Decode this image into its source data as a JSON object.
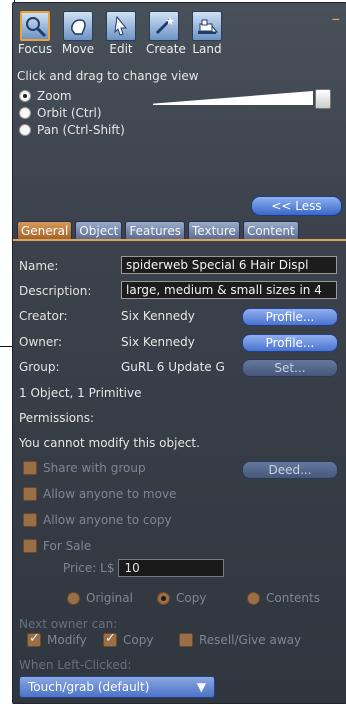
{
  "window": {
    "close_glyph": "–"
  },
  "tools": [
    {
      "label": "Focus",
      "icon": "magnifier-icon"
    },
    {
      "label": "Move",
      "icon": "hand-icon"
    },
    {
      "label": "Edit",
      "icon": "cursor-icon"
    },
    {
      "label": "Create",
      "icon": "wand-icon"
    },
    {
      "label": "Land",
      "icon": "bulldozer-icon"
    }
  ],
  "focus": {
    "hint": "Click and drag to change view",
    "options": [
      "Zoom",
      "Orbit (Ctrl)",
      "Pan (Ctrl-Shift)"
    ],
    "selected": "Zoom"
  },
  "less_button": "<< Less",
  "tabs": [
    "General",
    "Object",
    "Features",
    "Texture",
    "Content"
  ],
  "general": {
    "name_label": "Name:",
    "name_value": "spiderweb  Special 6  Hair Displ",
    "description_label": "Description:",
    "description_value": "large, medium & small sizes in 4",
    "creator_label": "Creator:",
    "creator_value": "Six Kennedy",
    "creator_button": "Profile...",
    "owner_label": "Owner:",
    "owner_value": "Six Kennedy",
    "owner_button": "Profile...",
    "group_label": "Group:",
    "group_value": "GuRL 6 Update G",
    "group_button": "Set...",
    "object_count": "1 Object, 1 Primitive",
    "permissions_label": "Permissions:",
    "permissions_notice": "You cannot modify this object.",
    "share_with_group": "Share with group",
    "deed_button": "Deed...",
    "allow_move": "Allow anyone to move",
    "allow_copy": "Allow anyone to copy",
    "for_sale": "For Sale",
    "price_label": "Price: L$",
    "price_value": "10",
    "sale_original": "Original",
    "sale_copy": "Copy",
    "sale_contents": "Contents",
    "next_owner_label": "Next owner can:",
    "modify": "Modify",
    "copy": "Copy",
    "resell": "Resell/Give away",
    "left_click_label": "When Left-Clicked:",
    "left_click_value": "Touch/grab (default)"
  },
  "colors": {
    "accent": "#f0a038",
    "button_blue": "#4a73d2",
    "panel": "#3c434c"
  }
}
